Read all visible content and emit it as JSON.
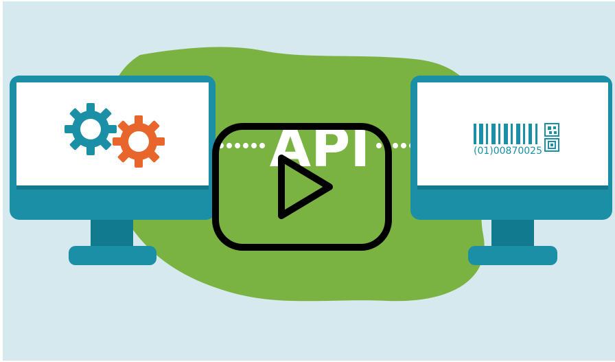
{
  "illustration": {
    "api_label": "API",
    "barcode_number": "(01)00870025",
    "left_screen_icon": "gears-icon",
    "right_screen_icon": "barcode-icon"
  },
  "player": {
    "play_icon": "play-icon"
  },
  "colors": {
    "background": "#d6e9ee",
    "blob": "#7ab342",
    "monitor_frame": "#1a8fa5",
    "monitor_dark": "#127a8e",
    "screen": "#ffffff",
    "gear_blue": "#1a8fa5",
    "gear_orange": "#e8662c",
    "barcode": "#1a8fa5",
    "play_outline": "#000000"
  }
}
